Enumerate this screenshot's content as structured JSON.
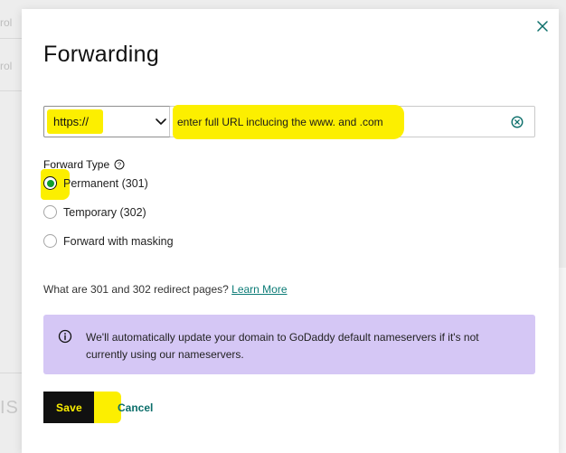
{
  "background": {
    "fragment_1": "rol",
    "fragment_2": "rol",
    "fragment_3": "IS"
  },
  "modal": {
    "title": "Forwarding",
    "close_icon": "close-icon"
  },
  "protocol": {
    "selected": "https://",
    "options": [
      "https://"
    ]
  },
  "url": {
    "value": "",
    "placeholder": "enter full URL inclucing the www. and .com"
  },
  "forward_type": {
    "label": "Forward Type",
    "options": [
      {
        "label": "Permanent (301)",
        "checked": true
      },
      {
        "label": "Temporary (302)",
        "checked": false
      },
      {
        "label": "Forward with masking",
        "checked": false
      }
    ]
  },
  "redirect_help": {
    "question": "What are 301 and 302 redirect pages?",
    "link": "Learn More"
  },
  "info": {
    "text": "We'll automatically update your domain to GoDaddy default nameservers if it's not currently using our nameservers."
  },
  "actions": {
    "save_label": "Save",
    "cancel_label": "Cancel"
  },
  "colors": {
    "highlight": "#fcef00",
    "info_bg": "#d5c7f5",
    "link": "#0b7b76",
    "radio_checked": "#0f9d2b",
    "save_bg": "#111111"
  }
}
